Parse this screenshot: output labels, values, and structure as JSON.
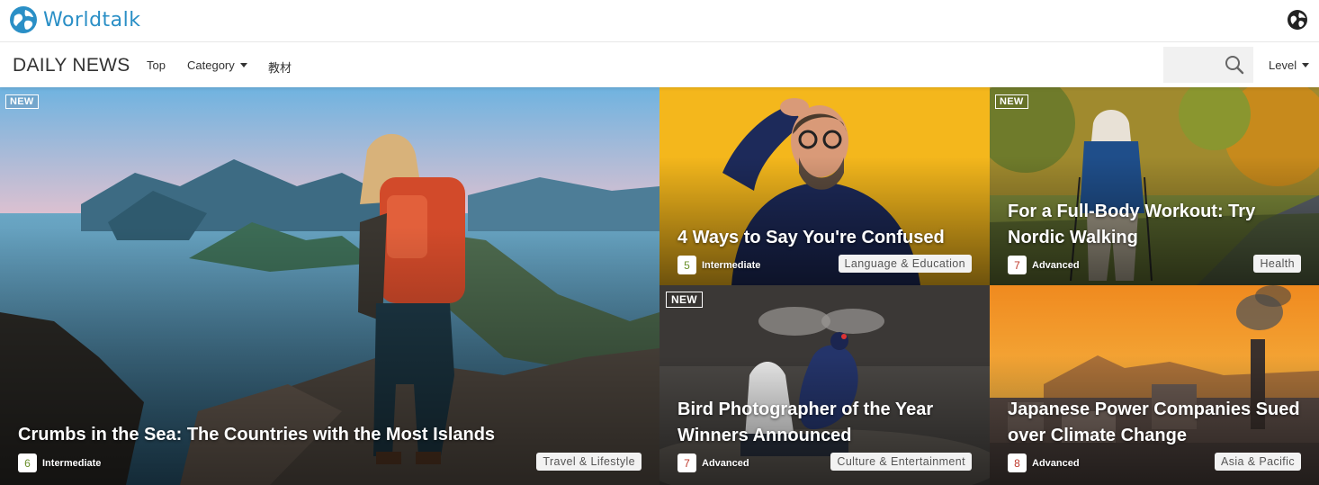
{
  "header": {
    "logo_text": "Worldtalk",
    "logo_icon": "globe-icon",
    "language_icon": "globe-icon"
  },
  "nav": {
    "brand": "DAILY NEWS",
    "top_label": "Top",
    "category_label": "Category",
    "materials_label": "教材",
    "level_label": "Level",
    "search_icon": "search-icon"
  },
  "colors": {
    "brand_blue": "#2a8fc6",
    "level_intermediate": "#6a8f2a",
    "level_advanced": "#c0392b"
  },
  "articles": [
    {
      "new": "NEW",
      "title": "Crumbs in the Sea: The Countries with the Most Islands",
      "level_num": "6",
      "level_text": "Intermediate",
      "category": "Travel & Lifestyle"
    },
    {
      "new": "",
      "title": "4 Ways to Say You're Confused",
      "level_num": "5",
      "level_text": "Intermediate",
      "category": "Language & Education"
    },
    {
      "new": "NEW",
      "title": "For a Full-Body Workout: Try Nordic Walking",
      "level_num": "7",
      "level_text": "Advanced",
      "category": "Health"
    },
    {
      "new": "NEW",
      "title": "Bird Photographer of the Year Winners Announced",
      "level_num": "7",
      "level_text": "Advanced",
      "category": "Culture & Entertainment"
    },
    {
      "new": "",
      "title": "Japanese Power Companies Sued over Climate Change",
      "level_num": "8",
      "level_text": "Advanced",
      "category": "Asia & Pacific"
    }
  ]
}
